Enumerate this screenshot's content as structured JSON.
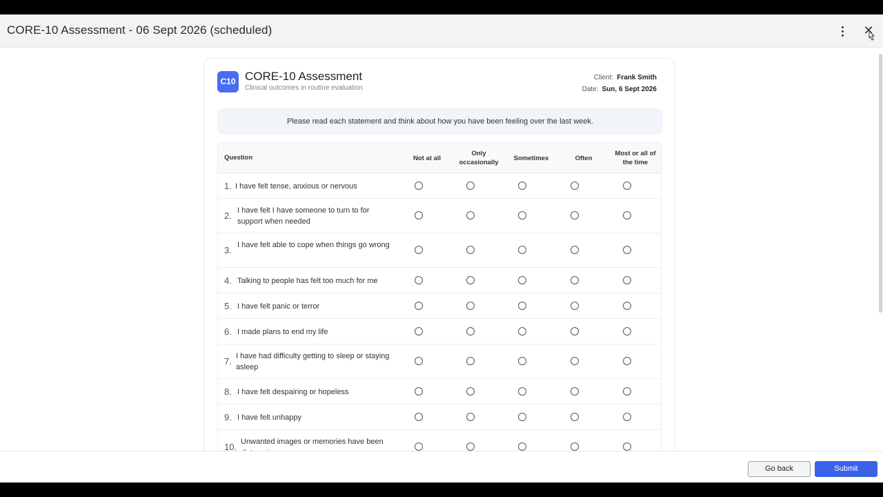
{
  "window": {
    "title": "CORE-10 Assessment - 06 Sept 2026 (scheduled)",
    "more_icon": "kebab-menu-icon",
    "close_label": "✕"
  },
  "card": {
    "logo": "C10",
    "title": "CORE-10 Assessment",
    "subtitle": "Clinical outcomes in routine evaluation",
    "client_label": "Client:",
    "client_value": "Frank Smith",
    "date_label": "Date:",
    "date_value": "Sun, 6 Sept 2026",
    "instructions": "Please read each statement and think about how you have been feeling over the last week."
  },
  "table": {
    "question_header": "Question",
    "options": [
      "Not at all",
      "Only occasionally",
      "Sometimes",
      "Often",
      "Most or all of the time"
    ],
    "rows": [
      {
        "num": "1.",
        "text": "I have felt tense, anxious or nervous"
      },
      {
        "num": "2.",
        "text": "I have felt I have someone to turn to for support when needed"
      },
      {
        "num": "3.",
        "text": "I have felt able to cope when things go wrong"
      },
      {
        "num": "4.",
        "text": "Talking to people has felt too much for me"
      },
      {
        "num": "5.",
        "text": "I have felt panic or terror"
      },
      {
        "num": "6.",
        "text": "I made plans to end my life"
      },
      {
        "num": "7.",
        "text": "I have had difficulty getting to sleep or staying asleep"
      },
      {
        "num": "8.",
        "text": "I have felt despairing or hopeless"
      },
      {
        "num": "9.",
        "text": "I have felt unhappy"
      },
      {
        "num": "10.",
        "text": "Unwanted images or memories have been distressing me"
      }
    ]
  },
  "footer": {
    "back_label": "Go back",
    "submit_label": "Submit"
  },
  "colors": {
    "accent": "#3b63ea",
    "logo_bg": "#4a6cf0",
    "header_bg": "#f1f3f5"
  }
}
